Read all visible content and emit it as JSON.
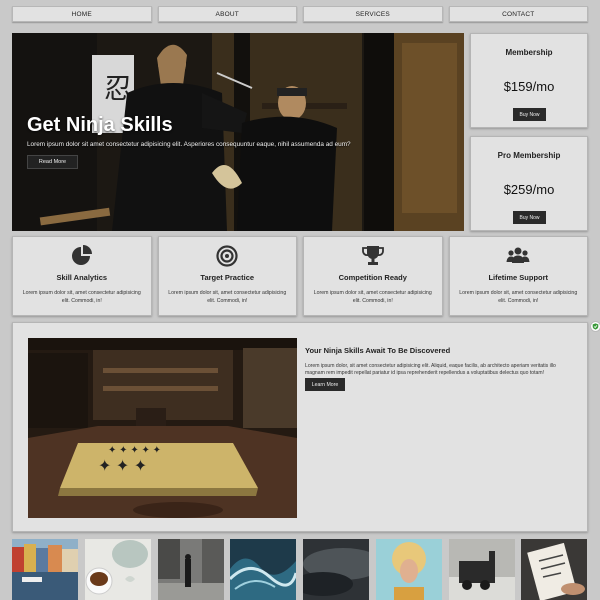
{
  "nav": {
    "items": [
      {
        "label": "HOME"
      },
      {
        "label": "ABOUT"
      },
      {
        "label": "SERVICES"
      },
      {
        "label": "CONTACT"
      }
    ]
  },
  "hero": {
    "title": "Get Ninja Skills",
    "text": "Lorem ipsum dolor sit amet consectetur adipisicing elit. Asperiores consequuntur eaque, nihil assumenda ad eum?",
    "button_label": "Read More"
  },
  "memberships": [
    {
      "title": "Membership",
      "price": "$159/mo",
      "button_label": "Buy Now"
    },
    {
      "title": "Pro Membership",
      "price": "$259/mo",
      "button_label": "Buy Now"
    }
  ],
  "features": [
    {
      "icon": "pie-chart-icon",
      "title": "Skill Analytics",
      "text": "Lorem ipsum dolor sit, amet consectetur adipisicing elit. Commodi, in!"
    },
    {
      "icon": "target-icon",
      "title": "Target Practice",
      "text": "Lorem ipsum dolor sit, amet consectetur adipisicing elit. Commodi, in!"
    },
    {
      "icon": "trophy-icon",
      "title": "Competition Ready",
      "text": "Lorem ipsum dolor sit, amet consectetur adipisicing elit. Commodi, in!"
    },
    {
      "icon": "users-icon",
      "title": "Lifetime Support",
      "text": "Lorem ipsum dolor sit, amet consectetur adipisicing elit. Commodi, in!"
    }
  ],
  "discover": {
    "title": "Your Ninja Skills Await To Be Discovered",
    "text": "Lorem ipsum dolor, sit amet consectetur adipisicing elit. Aliquid, eaque facilis, ab architecto aperiam veritatis illo magnam rem impedit repellat pariatur id ipsa reprehenderit repellendus a voluptatibus delectus quo totam!",
    "button_label": "Learn More"
  },
  "colors": {
    "page_bg": "#c9c9c9",
    "card_bg": "#e2e2e2",
    "button_bg": "#2a2a2a"
  }
}
